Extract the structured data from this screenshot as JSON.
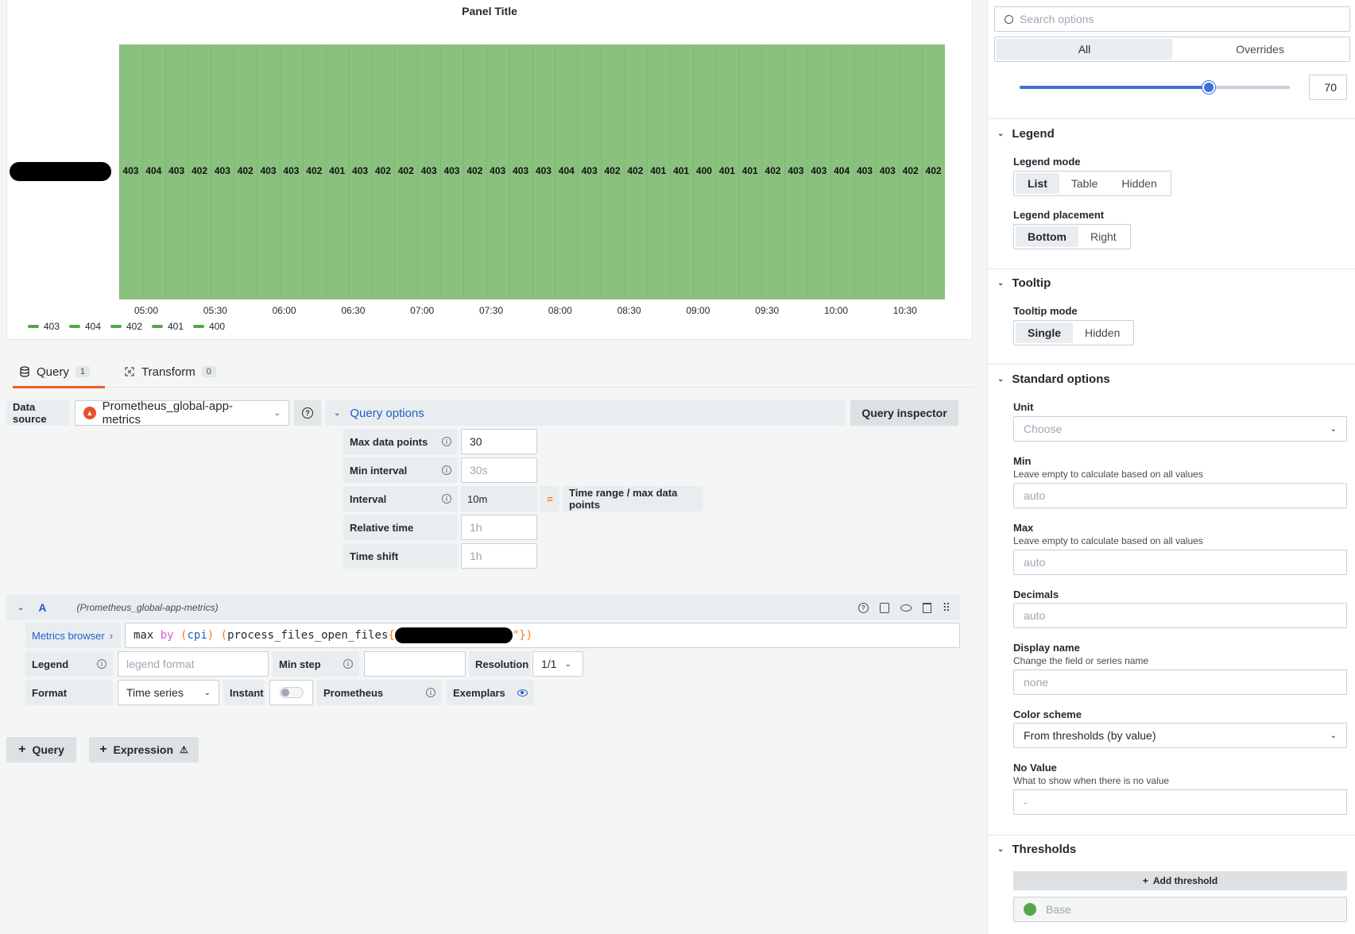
{
  "panel": {
    "title": "Panel Title",
    "cell_values": [
      "403",
      "404",
      "403",
      "402",
      "403",
      "402",
      "403",
      "403",
      "402",
      "401",
      "403",
      "402",
      "402",
      "403",
      "403",
      "402",
      "403",
      "403",
      "403",
      "404",
      "403",
      "402",
      "402",
      "401",
      "401",
      "400",
      "401",
      "401",
      "402",
      "403",
      "403",
      "404",
      "403",
      "403",
      "402",
      "402"
    ],
    "time_ticks": [
      "05:00",
      "05:30",
      "06:00",
      "06:30",
      "07:00",
      "07:30",
      "08:00",
      "08:30",
      "09:00",
      "09:30",
      "10:00",
      "10:30"
    ],
    "legend": [
      "403",
      "404",
      "402",
      "401",
      "400"
    ],
    "fill_color": "#8ac17f",
    "series_color": "#56a64b"
  },
  "tabs": {
    "query": {
      "label": "Query",
      "count": "1"
    },
    "transform": {
      "label": "Transform",
      "count": "0"
    }
  },
  "query_bar": {
    "datasource_label": "Data source",
    "datasource_value": "Prometheus_global-app-metrics",
    "options_label": "Query options",
    "inspector_label": "Query inspector"
  },
  "query_options": {
    "max_data_points": {
      "label": "Max data points",
      "value": "30"
    },
    "min_interval": {
      "label": "Min interval",
      "placeholder": "30s"
    },
    "interval": {
      "label": "Interval",
      "value": "10m",
      "eq": "=",
      "formula": "Time range / max data points"
    },
    "relative_time": {
      "label": "Relative time",
      "placeholder": "1h"
    },
    "time_shift": {
      "label": "Time shift",
      "placeholder": "1h"
    }
  },
  "query_a": {
    "ref": "A",
    "source": "(Prometheus_global-app-metrics)",
    "metrics_browser": "Metrics browser",
    "expr_max": "max",
    "expr_by": "by",
    "expr_group": "cpi",
    "expr_metric": "process_files_open_files",
    "expr_tail": "\"})",
    "legend_label": "Legend",
    "legend_placeholder": "legend format",
    "min_step_label": "Min step",
    "resolution_label": "Resolution",
    "resolution_value": "1/1",
    "format_label": "Format",
    "format_value": "Time series",
    "instant_label": "Instant",
    "prometheus_label": "Prometheus",
    "exemplars_label": "Exemplars"
  },
  "add_buttons": {
    "query": "Query",
    "expression": "Expression"
  },
  "sidebar": {
    "search_placeholder": "Search options",
    "tab_all": "All",
    "tab_overrides": "Overrides",
    "slider_value": "70",
    "slider_fraction": 0.7,
    "legend_title": "Legend",
    "legend_mode_label": "Legend mode",
    "legend_modes": [
      "List",
      "Table",
      "Hidden"
    ],
    "legend_placement_label": "Legend placement",
    "legend_placements": [
      "Bottom",
      "Right"
    ],
    "tooltip_title": "Tooltip",
    "tooltip_mode_label": "Tooltip mode",
    "tooltip_modes": [
      "Single",
      "Hidden"
    ],
    "standard_title": "Standard options",
    "unit_label": "Unit",
    "unit_placeholder": "Choose",
    "min_label": "Min",
    "min_desc": "Leave empty to calculate based on all values",
    "min_placeholder": "auto",
    "max_label": "Max",
    "max_desc": "Leave empty to calculate based on all values",
    "max_placeholder": "auto",
    "decimals_label": "Decimals",
    "decimals_placeholder": "auto",
    "display_name_label": "Display name",
    "display_name_desc": "Change the field or series name",
    "display_name_placeholder": "none",
    "color_scheme_label": "Color scheme",
    "color_scheme_value": "From thresholds (by value)",
    "no_value_label": "No Value",
    "no_value_desc": "What to show when there is no value",
    "no_value_placeholder": "-",
    "thresholds_title": "Thresholds",
    "add_threshold": "Add threshold",
    "base_label": "Base"
  }
}
